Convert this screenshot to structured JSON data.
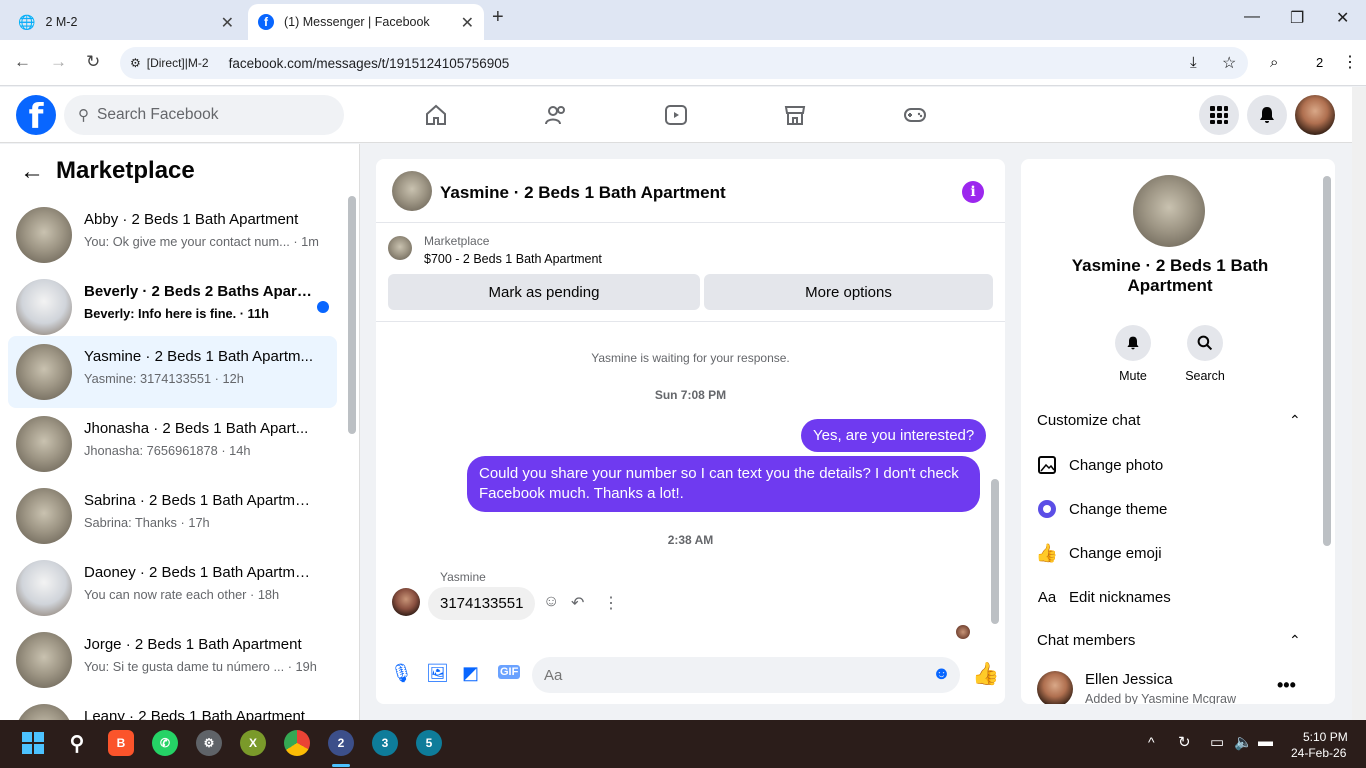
{
  "browser": {
    "tabs": [
      {
        "label": "2 M-2"
      },
      {
        "label": "(1) Messenger | Facebook"
      }
    ],
    "site_chip": "[Direct]|M-2",
    "url": "facebook.com/messages/t/1915124105756905",
    "profile_count": "2"
  },
  "fb": {
    "search_placeholder": "Search Facebook"
  },
  "left": {
    "title": "Marketplace",
    "conversations": [
      {
        "name": "Abby · 2 Beds 1 Bath Apartment",
        "sub": "You: Ok give me your contact num... · 1m"
      },
      {
        "name": "Beverly · 2 Beds 2 Baths Apart...",
        "sub": "Beverly: Info here is fine. · 11h"
      },
      {
        "name": "Yasmine · 2 Beds 1 Bath Apartm...",
        "sub": "Yasmine: 3174133551 · 12h"
      },
      {
        "name": "Jhonasha · 2 Beds 1 Bath Apart...",
        "sub": "Jhonasha: 7656961878 · 14h"
      },
      {
        "name": "Sabrina · 2 Beds 1 Bath Apartment",
        "sub": "Sabrina: Thanks · 17h"
      },
      {
        "name": "Daoney · 2 Beds 1 Bath Apartment",
        "sub": "You can now rate each other · 18h"
      },
      {
        "name": "Jorge · 2 Beds 1 Bath Apartment",
        "sub": "You: Si te gusta dame tu número ... · 19h"
      },
      {
        "name": "Leany · 2 Beds 1 Bath Apartment",
        "sub": ""
      }
    ]
  },
  "chat": {
    "title": "Yasmine · 2 Beds 1 Bath Apartment",
    "marketplace_label": "Marketplace",
    "item": "$700 - 2 Beds 1 Bath Apartment",
    "btn_pending": "Mark as pending",
    "btn_more": "More options",
    "waiting": "Yasmine is waiting for your response.",
    "time1": "Sun 7:08 PM",
    "msg_out1": "Yes, are you interested?",
    "msg_out2": "Could you share your number so I can text you the details? I don't check Facebook much. Thanks a lot!.",
    "time2": "2:38 AM",
    "sender": "Yasmine",
    "msg_in": "3174133551",
    "input_placeholder": "Aa"
  },
  "right": {
    "name": "Yasmine · 2 Beds 1 Bath Apartment",
    "mute": "Mute",
    "search": "Search",
    "customize": "Customize chat",
    "change_photo": "Change photo",
    "change_theme": "Change theme",
    "change_emoji": "Change emoji",
    "edit_nicknames": "Edit nicknames",
    "members": "Chat members",
    "member_name": "Ellen Jessica",
    "member_sub": "Added by Yasmine Mcgraw"
  },
  "taskbar": {
    "time": "5:10 PM",
    "date": "24-Feb-26",
    "badges": [
      "2",
      "3",
      "5"
    ]
  },
  "colors": {
    "brand": "#0866ff",
    "bubble_out": "#6f3af0",
    "active_conv": "#ebf5ff"
  }
}
